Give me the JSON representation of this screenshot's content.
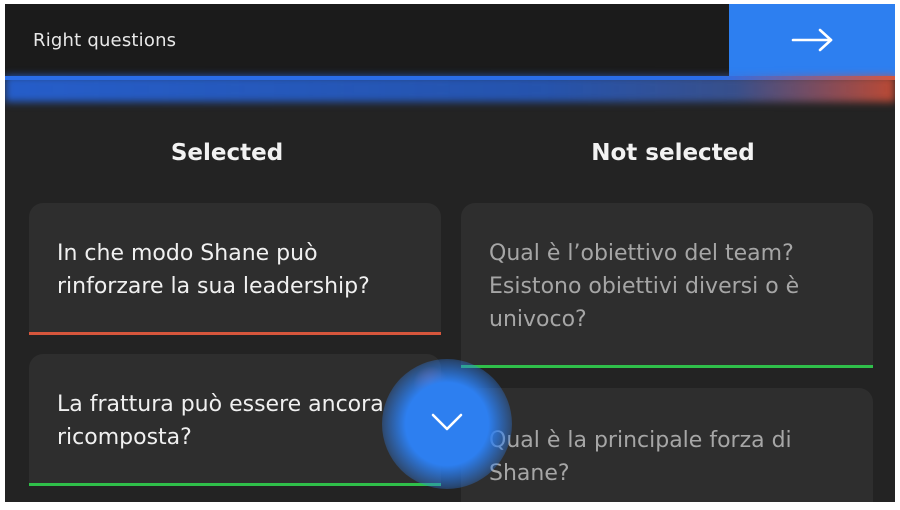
{
  "header": {
    "title": "Right questions",
    "next_icon": "arrow-right-icon"
  },
  "columns": {
    "selected_title": "Selected",
    "not_selected_title": "Not selected"
  },
  "selected_cards": [
    {
      "text": "In che modo Shane può rinforzare la sua leadership?",
      "accent": "#d6563c"
    },
    {
      "text": "La frattura può essere ancora ricomposta?",
      "accent": "#2fbf4a"
    }
  ],
  "not_selected_cards": [
    {
      "text": "Qual è l’obiettivo del team? Esistono obiettivi diversi o è univoco?",
      "accent": "#2fbf4a"
    },
    {
      "text": "Qual è la principale forza di Shane?",
      "accent": ""
    }
  ],
  "scroll_button": {
    "icon": "chevron-down-icon"
  },
  "colors": {
    "background": "#232323",
    "header": "#1b1b1b",
    "primary": "#2d7ff0",
    "card": "#2e2e2e",
    "red_accent": "#d6563c",
    "green_accent": "#2fbf4a"
  }
}
